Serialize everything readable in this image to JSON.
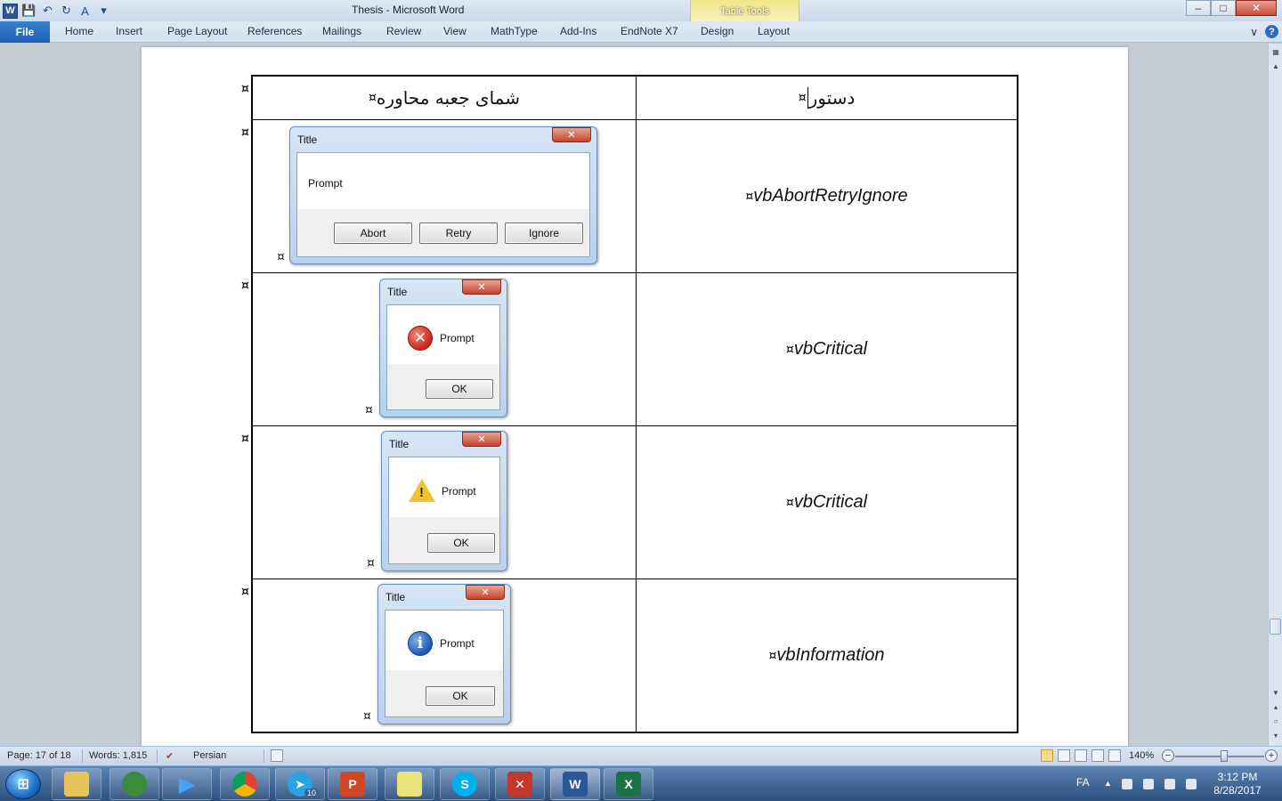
{
  "window": {
    "title": "Thesis - Microsoft Word",
    "contextual_group": "Table Tools",
    "minimize": "–",
    "maximize": "□",
    "close": "✕"
  },
  "quick_access": {
    "app_letter": "W",
    "save": "💾",
    "undo": "↶",
    "redo": "↻",
    "format": "A",
    "customize": "▾"
  },
  "ribbon": {
    "file": "File",
    "tabs": [
      "Home",
      "Insert",
      "Page Layout",
      "References",
      "Mailings",
      "Review",
      "View",
      "MathType",
      "Add-Ins",
      "EndNote X7",
      "Design",
      "Layout"
    ],
    "minimize_ribbon": "∨",
    "help": "?"
  },
  "table": {
    "header_right": "دستور",
    "header_left": "شمای جعبه محاوره",
    "mark": "¤",
    "rows": [
      {
        "command": "vbAbortRetryIgnore",
        "dialog": {
          "title": "Title",
          "prompt": "Prompt",
          "buttons": [
            "Abort",
            "Retry",
            "Ignore"
          ],
          "icon": "none"
        }
      },
      {
        "command": "vbCritical",
        "dialog": {
          "title": "Title",
          "prompt": "Prompt",
          "buttons": [
            "OK"
          ],
          "icon": "critical-icon"
        }
      },
      {
        "command": "vbCritical",
        "dialog": {
          "title": "Title",
          "prompt": "Prompt",
          "buttons": [
            "OK"
          ],
          "icon": "warning-icon"
        }
      },
      {
        "command": "vbInformation",
        "dialog": {
          "title": "Title",
          "prompt": "Prompt",
          "buttons": [
            "OK"
          ],
          "icon": "info-icon"
        }
      }
    ]
  },
  "status": {
    "page": "Page: 17 of 18",
    "words": "Words: 1,815",
    "language": "Persian",
    "zoom": "140%",
    "zoom_minus": "−",
    "zoom_plus": "+"
  },
  "taskbar": {
    "telegram_badge": "10",
    "lang": "FA",
    "time": "3:12 PM",
    "date": "8/28/2017"
  },
  "colors": {
    "word_blue": "#2b5797",
    "table_tools": "#f2e88a",
    "close_red": "#c74b36"
  }
}
